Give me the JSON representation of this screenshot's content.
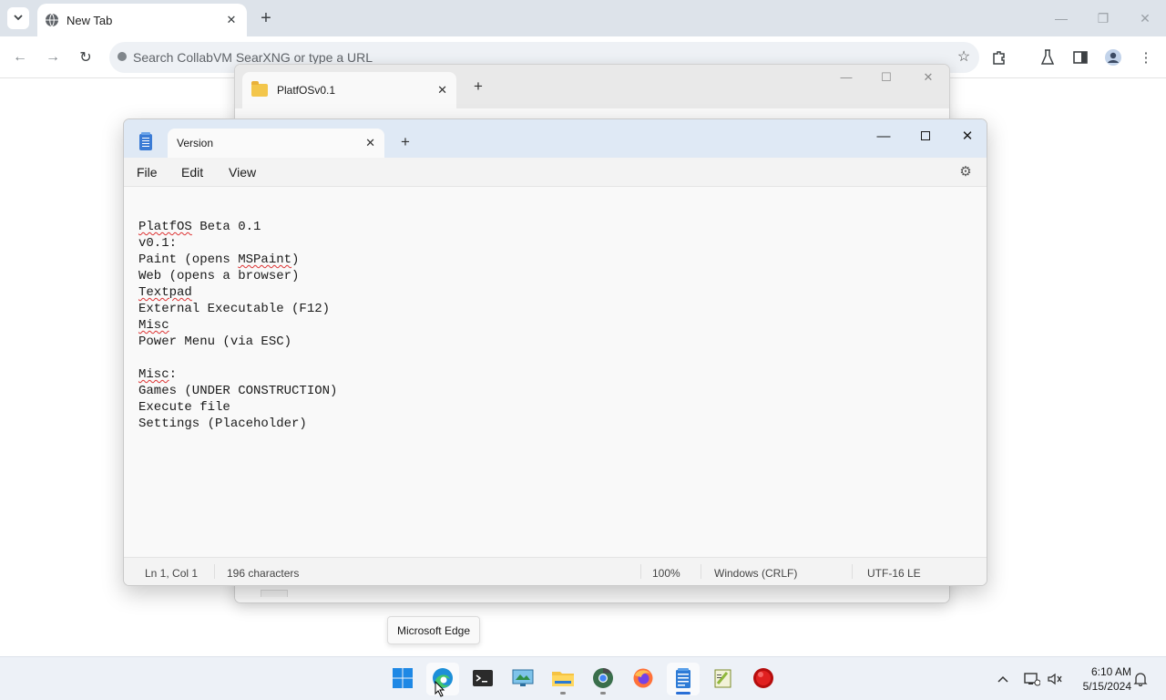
{
  "browser": {
    "tab_title": "New Tab",
    "omnibox_placeholder": "Search CollabVM SearXNG or type a URL"
  },
  "explorer": {
    "tab_title": "PlatfOSv0.1"
  },
  "notepad": {
    "tab_title": "Version",
    "menu": [
      "File",
      "Edit",
      "View"
    ],
    "content_lines": [
      "PlatfOS Beta 0.1",
      "v0.1:",
      "Paint (opens MSPaint)",
      "Web (opens a browser)",
      "Textpad",
      "External Executable (F12)",
      "Misc",
      "Power Menu (via ESC)",
      "",
      "Misc:",
      "Games (UNDER CONSTRUCTION)",
      "Execute file",
      "Settings (Placeholder)"
    ],
    "status": {
      "position": "Ln 1, Col 1",
      "characters": "196 characters",
      "zoom": "100%",
      "line_ending": "Windows (CRLF)",
      "encoding": "UTF-16 LE"
    }
  },
  "tooltip": "Microsoft Edge",
  "taskbar": {
    "items": [
      "start-icon",
      "edge-icon",
      "terminal-icon",
      "control-panel-icon",
      "file-explorer-icon",
      "chrome-icon",
      "firefox-icon",
      "notepad-icon",
      "notepad-plus-icon",
      "record-icon"
    ],
    "time": "6:10 AM",
    "date": "5/15/2024"
  },
  "colors": {
    "notepad_titlebar": "#dfe9f5",
    "taskbar": "#edf1f7",
    "accent": "#2a6fd6"
  }
}
